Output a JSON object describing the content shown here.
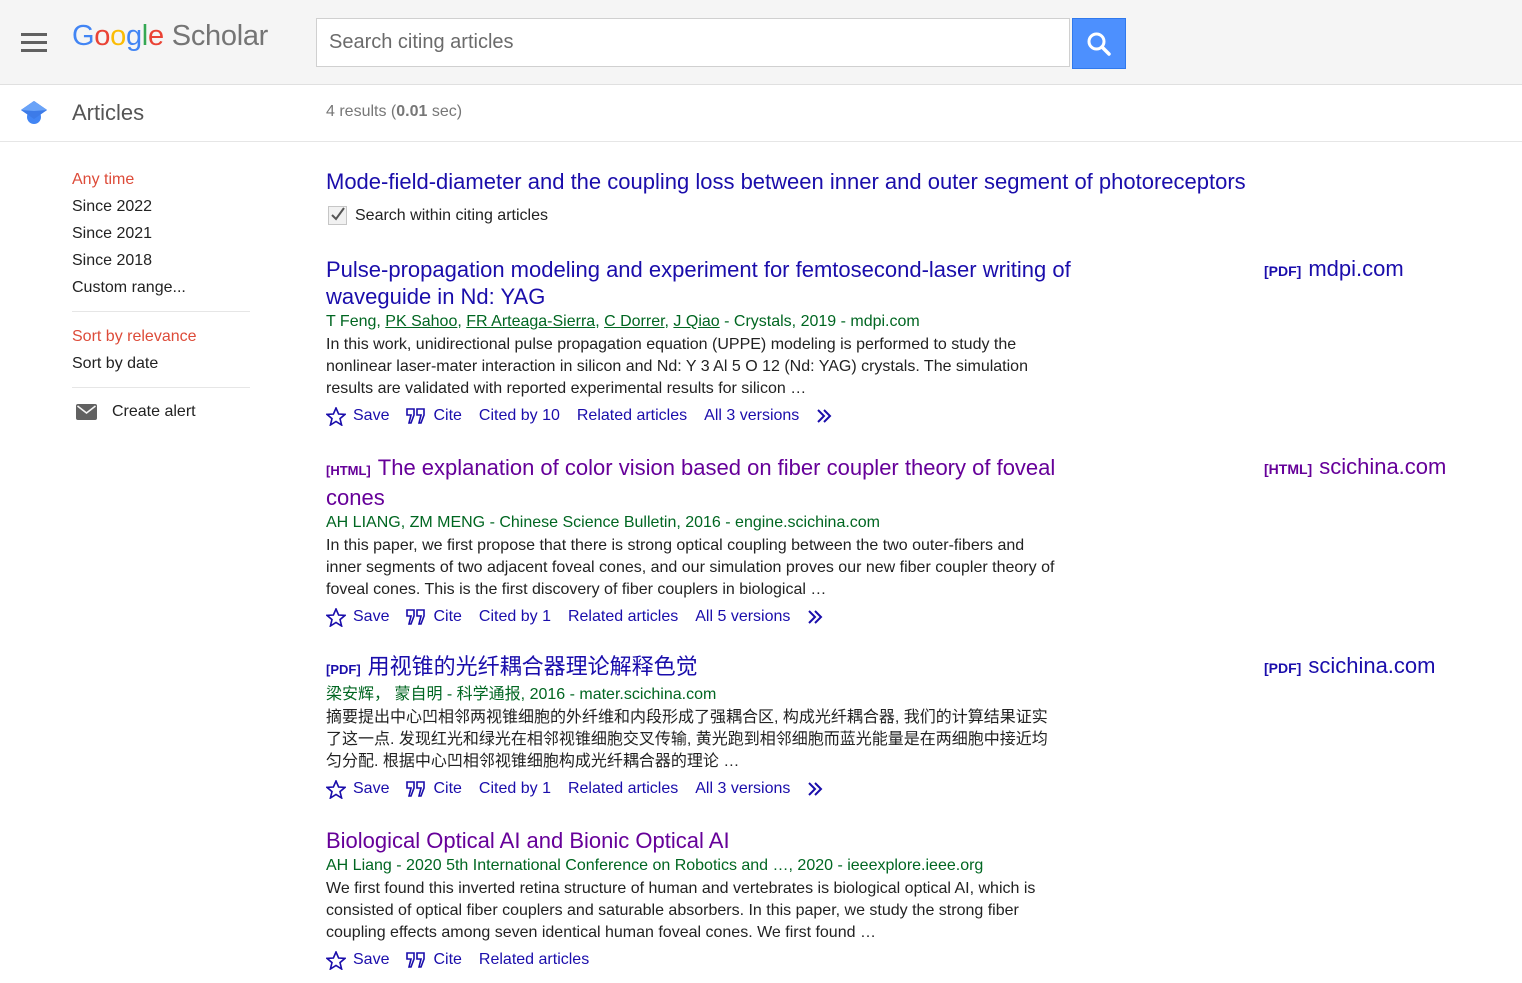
{
  "header": {
    "logo_letters": [
      "G",
      "o",
      "o",
      "g",
      "l",
      "e"
    ],
    "logo_suffix": "Scholar",
    "search_placeholder": "Search citing articles"
  },
  "subheader": {
    "section_label": "Articles",
    "results_prefix": "4 results (",
    "results_time": "0.01",
    "results_suffix": " sec)"
  },
  "sidebar": {
    "time_filters": [
      "Any time",
      "Since 2022",
      "Since 2021",
      "Since 2018",
      "Custom range..."
    ],
    "sort_options": [
      "Sort by relevance",
      "Sort by date"
    ],
    "create_alert": "Create alert"
  },
  "cited_paper": {
    "title": "Mode-field-diameter and the coupling loss between inner and outer segment of photoreceptors",
    "search_within": "Search within citing articles"
  },
  "results": [
    {
      "title": "Pulse-propagation modeling and experiment for femtosecond-laser writing of waveguide in Nd: YAG",
      "authors_plain": "T Feng, ",
      "author_links": [
        "PK Sahoo",
        "FR Arteaga-Sierra",
        "C Dorrer",
        "J Qiao"
      ],
      "source": " - Crystals, 2019 - mdpi.com",
      "snippet": "In this work, unidirectional pulse propagation equation (UPPE) modeling is performed to study the nonlinear laser-mater interaction in silicon and Nd: Y 3 Al 5 O 12 (Nd: YAG) crystals. The simulation results are validated with reported experimental results for silicon …",
      "save": "Save",
      "cite": "Cite",
      "cited_by": "Cited by 10",
      "related": "Related articles",
      "versions": "All 3 versions",
      "side_tag": "[PDF]",
      "side_domain": "mdpi.com"
    },
    {
      "tag": "[HTML]",
      "title": "The explanation of color vision based on fiber coupler theory of foveal cones",
      "authors_plain": "AH LIANG, ZM MENG",
      "source": " - Chinese Science Bulletin, 2016 - engine.scichina.com",
      "snippet": "In this paper, we first propose that there is strong optical coupling between the two outer-fibers and inner segments of two adjacent foveal cones, and our simulation proves our new fiber coupler theory of foveal cones. This is the first discovery of fiber couplers in biological …",
      "save": "Save",
      "cite": "Cite",
      "cited_by": "Cited by 1",
      "related": "Related articles",
      "versions": "All 5 versions",
      "side_tag": "[HTML]",
      "side_domain": "scichina.com"
    },
    {
      "tag": "[PDF]",
      "title": "用视锥的光纤耦合器理论解释色觉",
      "authors_plain": "梁安辉，  蒙自明",
      "source": " - 科学通报, 2016 - mater.scichina.com",
      "snippet": "摘要提出中心凹相邻两视锥细胞的外纤维和内段形成了强耦合区, 构成光纤耦合器, 我们的计算结果证实了这一点. 发现红光和绿光在相邻视锥细胞交叉传输, 黄光跑到相邻细胞而蓝光能量是在两细胞中接近均匀分配. 根据中心凹相邻视锥细胞构成光纤耦合器的理论 …",
      "save": "Save",
      "cite": "Cite",
      "cited_by": "Cited by 1",
      "related": "Related articles",
      "versions": "All 3 versions",
      "side_tag": "[PDF]",
      "side_domain": "scichina.com"
    },
    {
      "title": "Biological Optical AI and Bionic Optical AI",
      "authors_plain": "AH Liang",
      "source": " - 2020 5th International Conference on Robotics and …, 2020 - ieeexplore.ieee.org",
      "snippet": "We first found this inverted retina structure of human and vertebrates is biological optical AI, which is consisted of optical fiber couplers and saturable absorbers. In this paper, we study the strong fiber coupling effects among seven identical human foveal cones. We first found …",
      "save": "Save",
      "cite": "Cite",
      "related": "Related articles"
    }
  ],
  "colors": {
    "link": "#1a0dab",
    "visited": "#660099",
    "author_green": "#006621",
    "active_red": "#dd4b39",
    "search_button": "#4d90fe"
  }
}
